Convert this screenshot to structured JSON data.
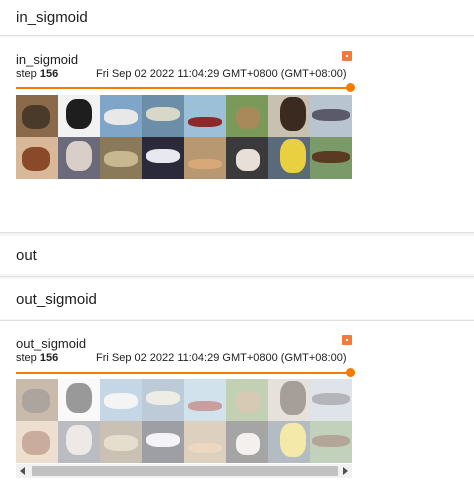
{
  "sections": {
    "in_sigmoid_header": "in_sigmoid",
    "out_header": "out",
    "out_sigmoid_header": "out_sigmoid"
  },
  "cards": [
    {
      "title": "in_sigmoid",
      "step_label": "step",
      "step_value": "156",
      "timestamp": "Fri Sep 02 2022 11:04:29 GMT+0800 (GMT+08:00)",
      "slider_position": 1.0,
      "faded": false,
      "expand_icon": "expand-icon"
    },
    {
      "title": "out_sigmoid",
      "step_label": "step",
      "step_value": "156",
      "timestamp": "Fri Sep 02 2022 11:04:29 GMT+0800 (GMT+08:00)",
      "slider_position": 1.0,
      "faded": true,
      "expand_icon": "expand-icon"
    }
  ],
  "image_grid": {
    "rows": 2,
    "cols": 8,
    "tiles": [
      {
        "name": "person-on-horse",
        "bg": "#8a6a4a",
        "fg": "#4a3a2a"
      },
      {
        "name": "black-white-dog",
        "bg": "#f2f2f2",
        "fg": "#1e1e1e"
      },
      {
        "name": "boat-on-water",
        "bg": "#7fa6c8",
        "fg": "#e8e8e8"
      },
      {
        "name": "airplane-flying",
        "bg": "#6c8ea8",
        "fg": "#d8d8c8"
      },
      {
        "name": "ship-red-hull",
        "bg": "#9cc0d8",
        "fg": "#8a2a2a"
      },
      {
        "name": "deer-in-grass",
        "bg": "#7a9a5a",
        "fg": "#a88a5a"
      },
      {
        "name": "dark-horse",
        "bg": "#c8c0b0",
        "fg": "#3a2a20"
      },
      {
        "name": "jet-airplane",
        "bg": "#b8c4d0",
        "fg": "#5a5a6a"
      },
      {
        "name": "cat-orange",
        "bg": "#d8b898",
        "fg": "#8a4a2a"
      },
      {
        "name": "dog-face",
        "bg": "#6a6a7a",
        "fg": "#d8d0c8"
      },
      {
        "name": "cat-tabby",
        "bg": "#8a7a5a",
        "fg": "#c8b890"
      },
      {
        "name": "white-cat",
        "bg": "#2a2a3a",
        "fg": "#e8e8f0"
      },
      {
        "name": "dog-brown",
        "bg": "#b89870",
        "fg": "#d8a878"
      },
      {
        "name": "puppy-black-white",
        "bg": "#3a3a3a",
        "fg": "#e8e0d8"
      },
      {
        "name": "yellow-car",
        "bg": "#5a6a7a",
        "fg": "#e8d040"
      },
      {
        "name": "brown-horse",
        "bg": "#7a9a6a",
        "fg": "#5a3a20"
      }
    ]
  }
}
